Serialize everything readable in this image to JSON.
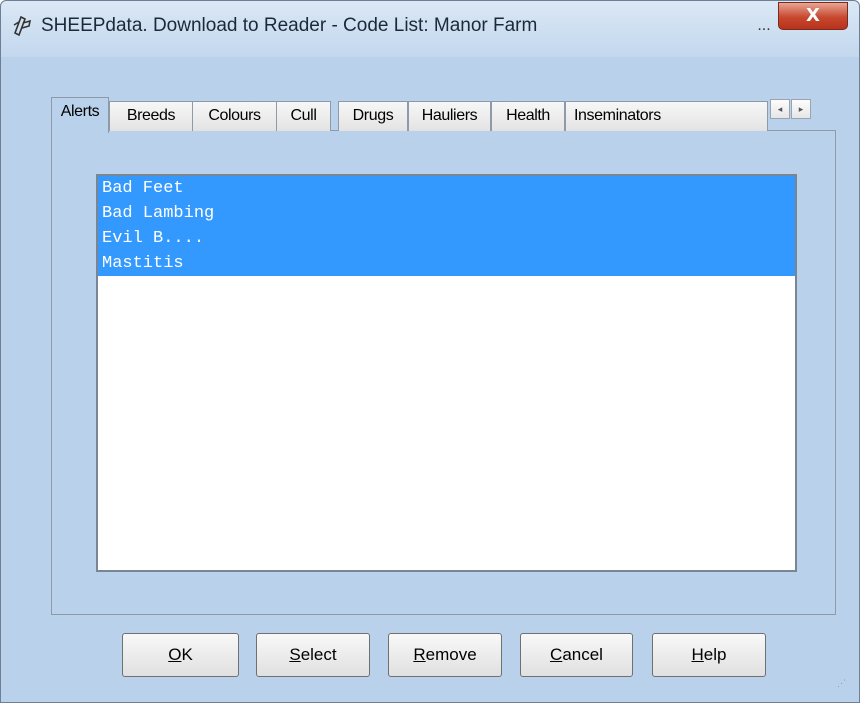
{
  "window": {
    "title": "SHEEPdata. Download to Reader - Code List: Manor Farm",
    "ellipsis": "...",
    "close_glyph": "X"
  },
  "tabs": [
    {
      "label": "Alerts",
      "active": true
    },
    {
      "label": "Breeds",
      "active": false
    },
    {
      "label": "Colours",
      "active": false
    },
    {
      "label": "Cull",
      "active": false
    },
    {
      "label": "Drugs",
      "active": false
    },
    {
      "label": "Hauliers",
      "active": false
    },
    {
      "label": "Health",
      "active": false
    },
    {
      "label": "Inseminators",
      "active": false
    }
  ],
  "tab_scroll": {
    "left_glyph": "◂",
    "right_glyph": "▸"
  },
  "list": {
    "items": [
      "Bad Feet",
      "Bad Lambing",
      "Evil B....",
      "Mastitis"
    ],
    "selection_color": "#3399ff"
  },
  "buttons": {
    "ok": {
      "mnemonic": "O",
      "rest": "K"
    },
    "select": {
      "mnemonic": "S",
      "rest": "elect"
    },
    "remove": {
      "mnemonic": "R",
      "rest": "emove"
    },
    "cancel": {
      "mnemonic": "C",
      "rest": "ancel"
    },
    "help": {
      "mnemonic": "H",
      "rest": "elp"
    }
  }
}
